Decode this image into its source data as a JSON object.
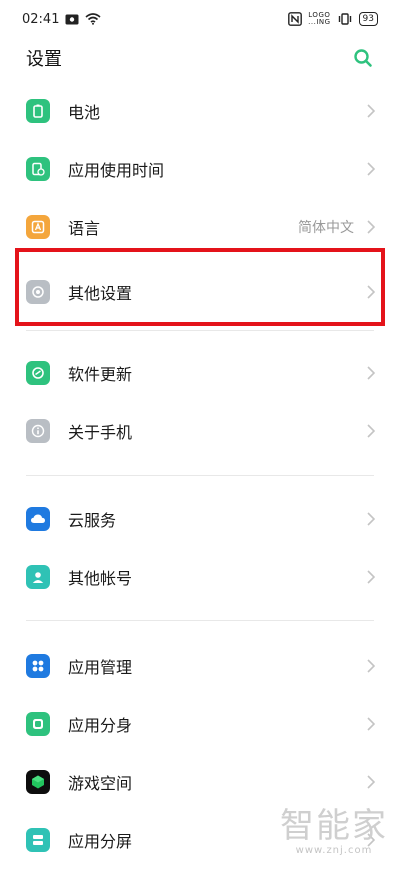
{
  "status_bar": {
    "time": "02:41",
    "logo_top": "LOGO",
    "logo_bottom": "...ING",
    "battery": "93"
  },
  "header": {
    "title": "设置"
  },
  "items": [
    {
      "label": "电池",
      "icon": "battery-icon",
      "color": "#2ec27e"
    },
    {
      "label": "应用使用时间",
      "icon": "hourglass-icon",
      "color": "#2ec27e"
    },
    {
      "label": "语言",
      "value": "简体中文",
      "icon": "language-icon",
      "color": "#f4a63c"
    },
    {
      "label": "其他设置",
      "icon": "other-settings-icon",
      "color": "#b9bec4"
    },
    {
      "label": "软件更新",
      "icon": "update-icon",
      "color": "#2ec27e"
    },
    {
      "label": "关于手机",
      "icon": "info-icon",
      "color": "#b9bec4"
    },
    {
      "label": "云服务",
      "icon": "cloud-icon",
      "color": "#1f7ae0"
    },
    {
      "label": "其他帐号",
      "icon": "account-icon",
      "color": "#2fc2b5"
    },
    {
      "label": "应用管理",
      "icon": "apps-icon",
      "color": "#1f7ae0"
    },
    {
      "label": "应用分身",
      "icon": "app-clone-icon",
      "color": "#2ec27e"
    },
    {
      "label": "游戏空间",
      "icon": "game-space-icon",
      "color": "#0f8a3a"
    },
    {
      "label": "应用分屏",
      "icon": "split-screen-icon",
      "color": "#2fc2b5"
    }
  ],
  "watermark": {
    "main": "智能家",
    "sub": "www.znj.com"
  },
  "colors": {
    "accent": "#2ec27e",
    "highlight": "#e4131a"
  }
}
